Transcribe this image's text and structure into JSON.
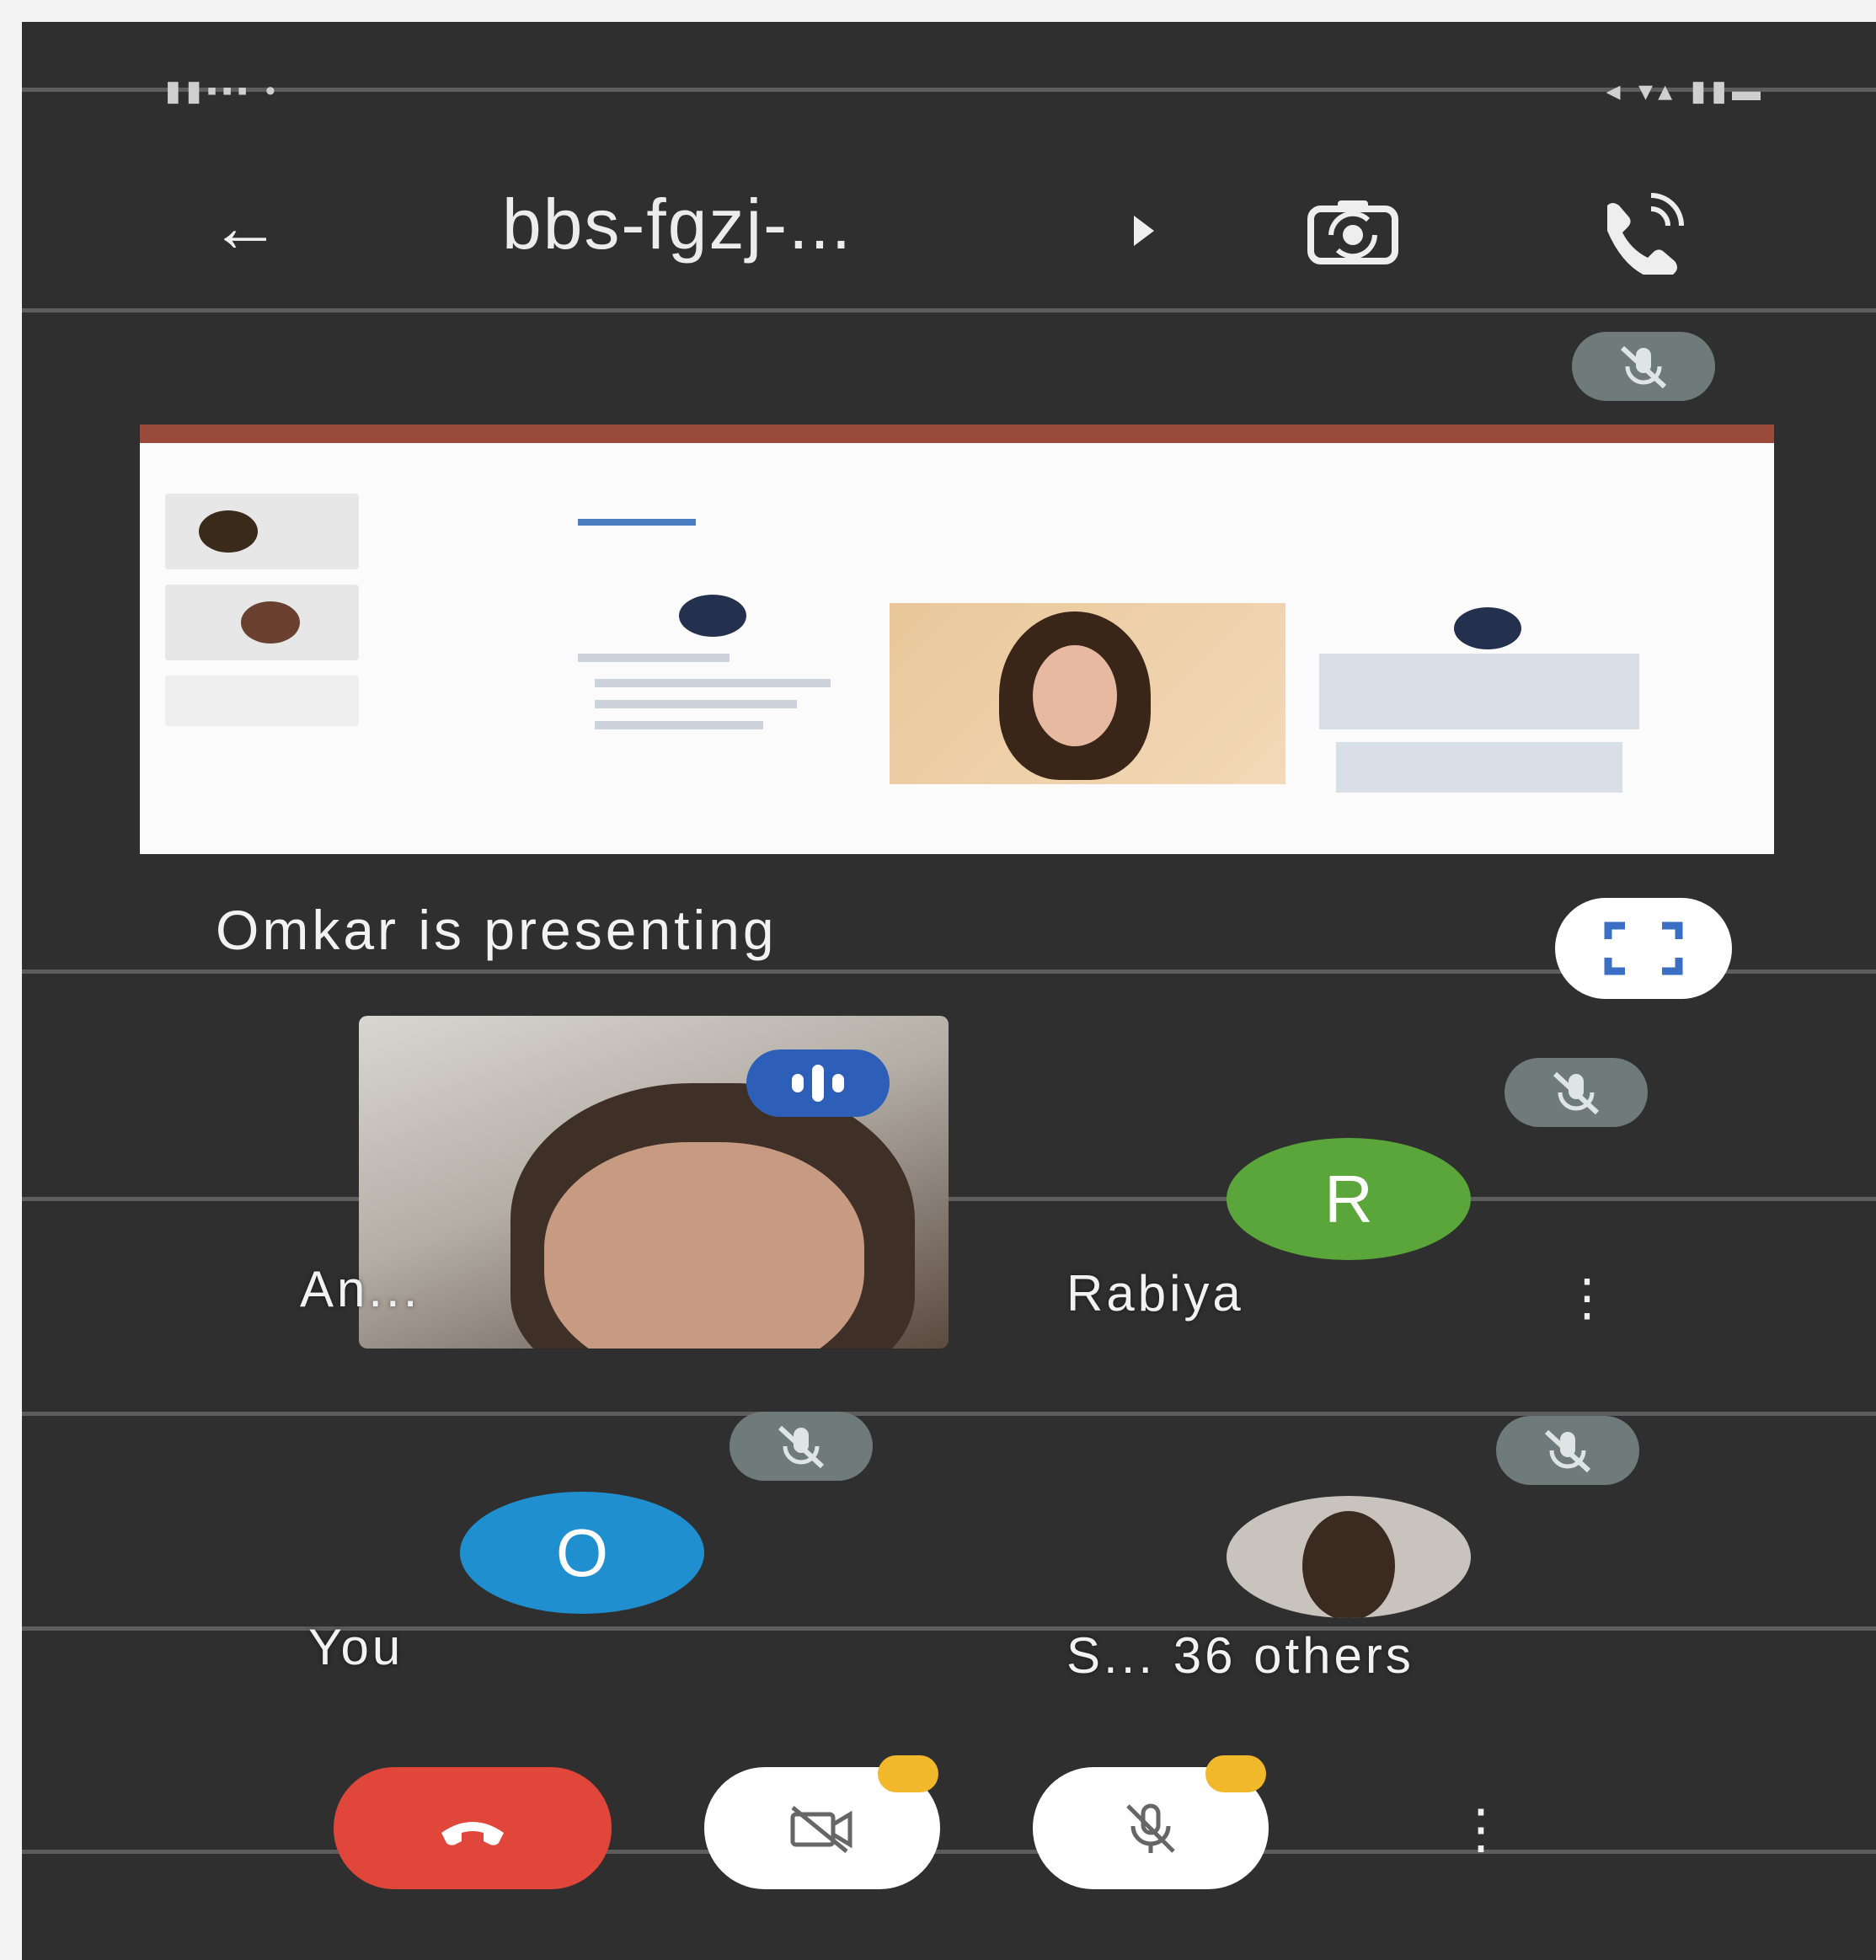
{
  "header": {
    "meeting_title": "bbs-fgzj-...",
    "back_icon": "arrow-left-icon",
    "switch_camera_icon": "switch-camera-icon",
    "audio_output_icon": "phone-audio-icon"
  },
  "presentation": {
    "label": "Omkar is presenting",
    "fullscreen_icon": "fullscreen-icon"
  },
  "participants": [
    {
      "name": "An...",
      "video": true,
      "speaking": true
    },
    {
      "name": "Rabiya",
      "initial": "R",
      "avatar_color": "#5aa63b",
      "muted": true
    },
    {
      "name": "You",
      "initial": "O",
      "avatar_color": "#1f8fcf",
      "muted": true
    },
    {
      "name": "S... 36 others",
      "muted": true
    }
  ],
  "controls": {
    "end_call_icon": "end-call-icon",
    "camera_icon": "camera-off-icon",
    "mic_icon": "mic-off-icon",
    "more_icon": "more-vertical-icon",
    "end_call_color": "#e0463a"
  },
  "colors": {
    "background": "#2f2f2f",
    "mute_pill": "#6f7a7a",
    "speaking": "#2d5fb8",
    "badge": "#f0b82a"
  }
}
